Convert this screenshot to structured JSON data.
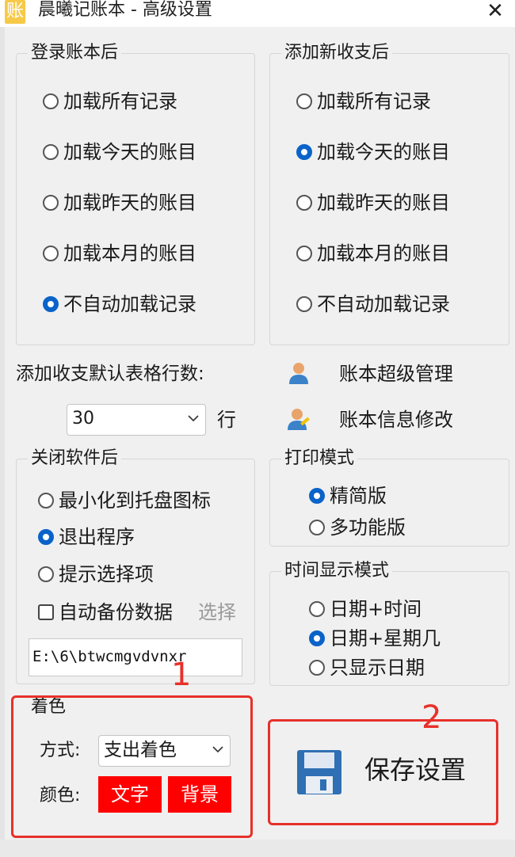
{
  "window": {
    "app_icon_glyph": "账",
    "title": "晨曦记账本 - 高级设置",
    "close_glyph": "✕"
  },
  "after_login": {
    "legend": "登录账本后",
    "options": [
      {
        "label": "加载所有记录",
        "checked": false
      },
      {
        "label": "加载今天的账目",
        "checked": false
      },
      {
        "label": "加载昨天的账目",
        "checked": false
      },
      {
        "label": "加载本月的账目",
        "checked": false
      },
      {
        "label": "不自动加载记录",
        "checked": true
      }
    ]
  },
  "after_add": {
    "legend": "添加新收支后",
    "options": [
      {
        "label": "加载所有记录",
        "checked": false
      },
      {
        "label": "加载今天的账目",
        "checked": true
      },
      {
        "label": "加载昨天的账目",
        "checked": false
      },
      {
        "label": "加载本月的账目",
        "checked": false
      },
      {
        "label": "不自动加载记录",
        "checked": false
      }
    ]
  },
  "rows_setting": {
    "label": "添加收支默认表格行数:",
    "value": "30",
    "unit": "行"
  },
  "links": {
    "super_admin": "账本超级管理",
    "edit_info": "账本信息修改"
  },
  "on_close": {
    "legend": "关闭软件后",
    "options": [
      {
        "label": "最小化到托盘图标",
        "checked": false
      },
      {
        "label": "退出程序",
        "checked": true
      },
      {
        "label": "提示选择项",
        "checked": false
      }
    ],
    "backup_label": "自动备份数据",
    "backup_checked": false,
    "choose_label": "选择",
    "path_value": "E:\\6\\btwcmgvdvnxr"
  },
  "print_mode": {
    "legend": "打印模式",
    "options": [
      {
        "label": "精简版",
        "checked": true
      },
      {
        "label": "多功能版",
        "checked": false
      }
    ]
  },
  "time_mode": {
    "legend": "时间显示模式",
    "options": [
      {
        "label": "日期+时间",
        "checked": false
      },
      {
        "label": "日期+星期几",
        "checked": true
      },
      {
        "label": "只显示日期",
        "checked": false
      }
    ]
  },
  "coloring": {
    "legend": "着色",
    "method_label": "方式:",
    "method_value": "支出着色",
    "color_label": "颜色:",
    "text_button": "文字",
    "bg_button": "背景",
    "button_color": "#ff0000"
  },
  "save_button": {
    "label": "保存设置"
  },
  "annotations": {
    "one": "1",
    "two": "2",
    "color": "#e8302a"
  }
}
